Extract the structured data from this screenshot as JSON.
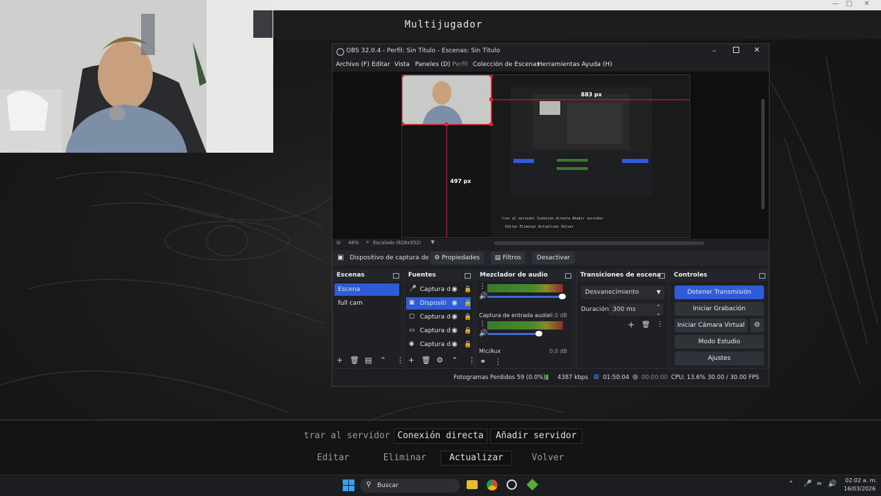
{
  "game": {
    "title": "Multijugador",
    "buttons_row1": [
      "trar al servidor",
      "Conexión directa",
      "Añadir servidor"
    ],
    "buttons_row2": [
      "Editar",
      "Eliminar",
      "Actualizar",
      "Volver"
    ]
  },
  "obs": {
    "title": "OBS 32.0.4 - Perfil: Sin Título - Escenas: Sin Título",
    "menu": [
      "Archivo (F)",
      "Editar",
      "Vista",
      "Paneles (D)",
      "Perfil",
      "Colección de Escenas",
      "Herramientas",
      "Ayuda (H)"
    ],
    "preview": {
      "measure_top": "883 px",
      "measure_left": "497 px",
      "zoom": "48%",
      "scale_label": "Escalado (626x352)"
    },
    "source_toolbar": {
      "source_name": "Dispositivo de captura de v",
      "properties": "Propiedades",
      "filters": "Filtros",
      "deactivate": "Desactivar"
    },
    "scenes": {
      "header": "Escenas",
      "items": [
        {
          "label": "Escena",
          "selected": true
        },
        {
          "label": "full cam",
          "selected": false
        }
      ]
    },
    "sources": {
      "header": "Fuentes",
      "items": [
        {
          "label": "Captura d",
          "icon": "mic-icon",
          "selected": false
        },
        {
          "label": "Dispositi",
          "icon": "camera-icon",
          "selected": true
        },
        {
          "label": "Captura d",
          "icon": "window-icon",
          "selected": false
        },
        {
          "label": "Captura d",
          "icon": "monitor-icon",
          "selected": false
        },
        {
          "label": "Captura d",
          "icon": "gamepad-icon",
          "selected": false
        }
      ]
    },
    "mixer": {
      "header": "Mezclador de audio",
      "channels": [
        {
          "name": "",
          "db": "",
          "level": 0.95
        },
        {
          "name": "Captura de entrada audio",
          "db": "-9.0 dB",
          "level": 0.65
        },
        {
          "name": "Mic/Aux",
          "db": "0.0 dB",
          "level": 0.95
        }
      ]
    },
    "transitions": {
      "header": "Transiciones de escena",
      "selected": "Desvanecimiento",
      "duration_label": "Duración",
      "duration_value": "300 ms"
    },
    "controls": {
      "header": "Controles",
      "buttons": [
        "Detener Transmisión",
        "Iniciar Grabación",
        "Iniciar Cámara Virtual",
        "Modo Estudio",
        "Ajustes"
      ]
    },
    "status": {
      "dropped": "Fotogramas Perdidos 59 (0.0%)",
      "bitrate": "4387 kbps",
      "stream_time": "01:50:04",
      "rec_time": "00:00:00",
      "cpu": "CPU: 13.6%",
      "fps": "30.00 / 30.00 FPS"
    }
  },
  "taskbar": {
    "search_placeholder": "Buscar",
    "time": "02:02 a. m.",
    "date": "16/03/2026"
  },
  "colors": {
    "accent": "#2e5cd8",
    "selection_red": "#e0202a",
    "panel": "#1e2024"
  }
}
